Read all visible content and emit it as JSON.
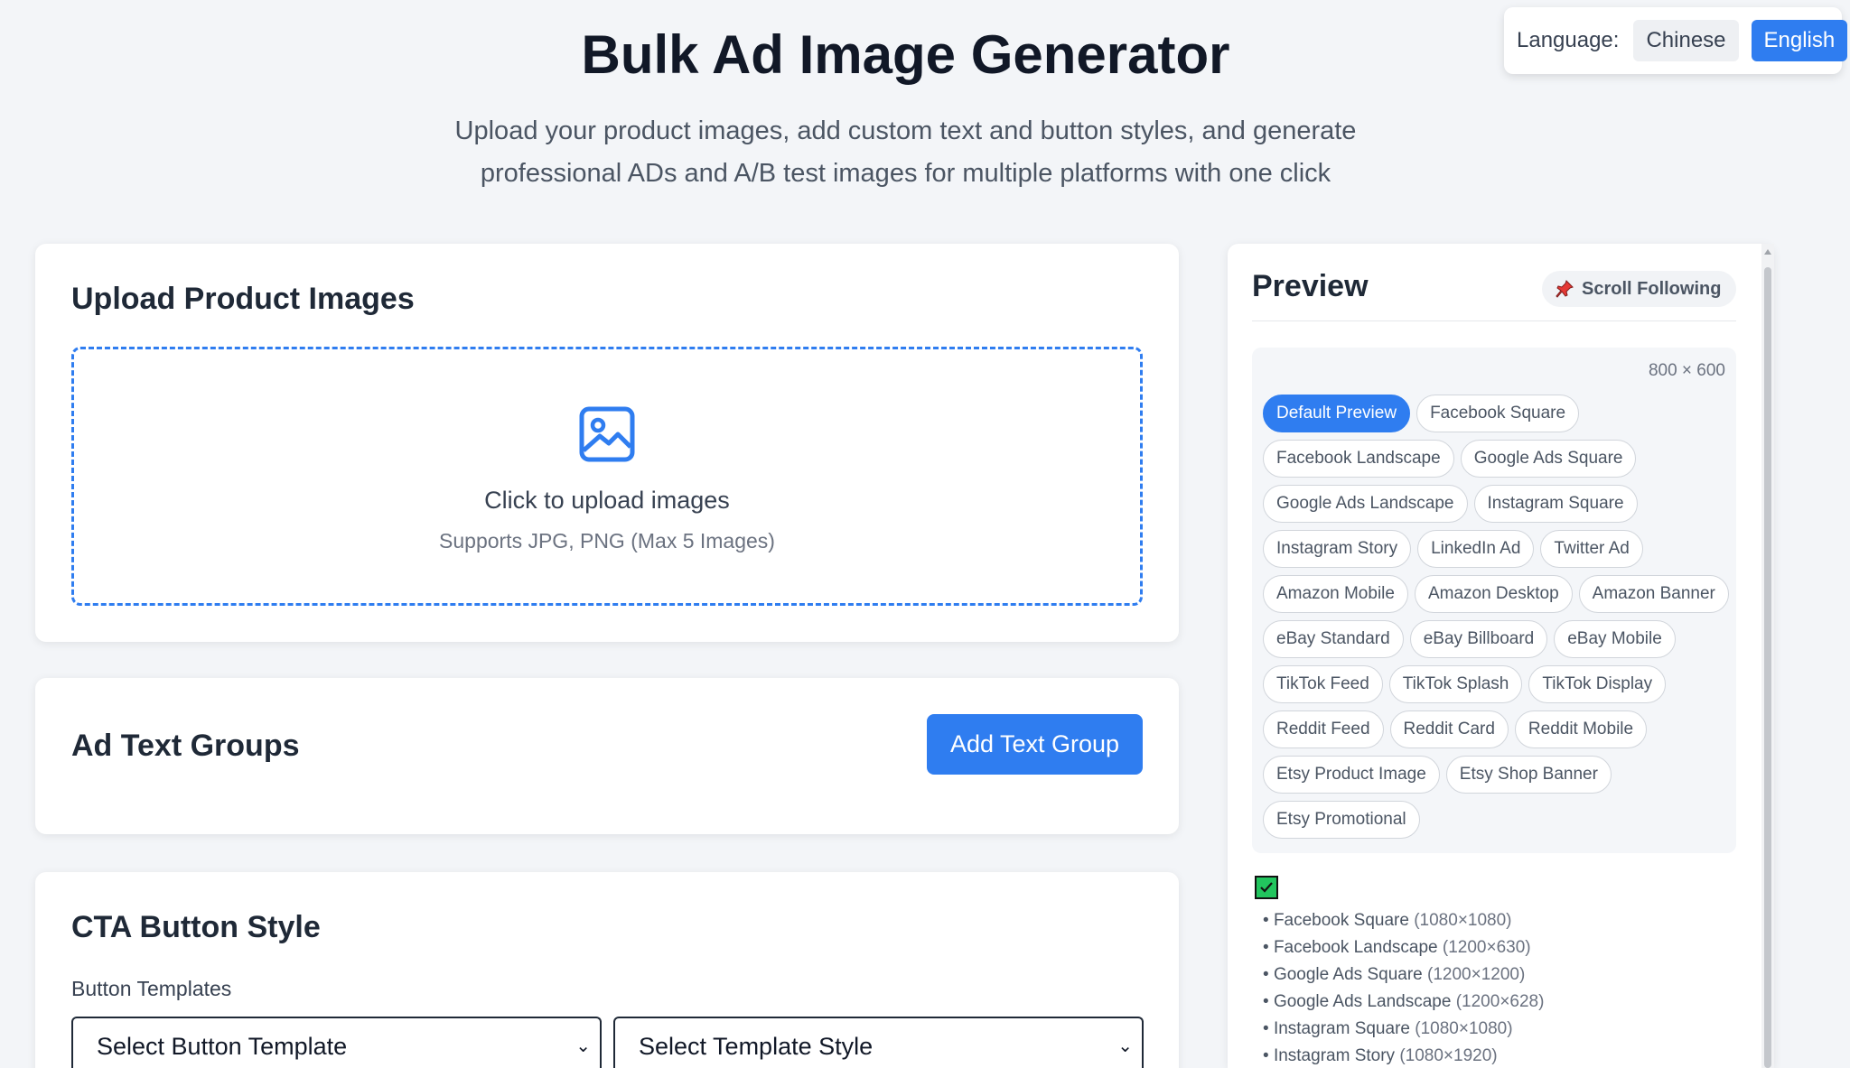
{
  "language": {
    "label": "Language:",
    "options": [
      "Chinese",
      "English"
    ],
    "selected": "English"
  },
  "header": {
    "title": "Bulk Ad Image Generator",
    "subtitle_line1": "Upload your product images, add custom text and button styles, and generate",
    "subtitle_line2": "professional ADs and A/B test images for multiple platforms with one click"
  },
  "upload": {
    "title": "Upload Product Images",
    "prompt": "Click to upload images",
    "hint": "Supports JPG, PNG (Max 5 Images)",
    "icon": "image-icon"
  },
  "text_groups": {
    "title": "Ad Text Groups",
    "add_label": "Add Text Group"
  },
  "cta": {
    "title": "CTA Button Style",
    "templates_label": "Button Templates",
    "template_select": "Select Button Template",
    "style_select": "Select Template Style"
  },
  "preview": {
    "title": "Preview",
    "scroll_following": "Scroll Following",
    "dimensions": "800 × 600",
    "sizes": [
      "Default Preview",
      "Facebook Square",
      "Facebook Landscape",
      "Google Ads Square",
      "Google Ads Landscape",
      "Instagram Square",
      "Instagram Story",
      "LinkedIn Ad",
      "Twitter Ad",
      "Amazon Mobile",
      "Amazon Desktop",
      "Amazon Banner",
      "eBay Standard",
      "eBay Billboard",
      "eBay Mobile",
      "TikTok Feed",
      "TikTok Splash",
      "TikTok Display",
      "Reddit Feed",
      "Reddit Card",
      "Reddit Mobile",
      "Etsy Product Image",
      "Etsy Shop Banner",
      "Etsy Promotional"
    ],
    "active_size": "Default Preview",
    "formats": [
      {
        "name": "Facebook Square",
        "dim": "(1080×1080)"
      },
      {
        "name": "Facebook Landscape",
        "dim": "(1200×630)"
      },
      {
        "name": "Google Ads Square",
        "dim": "(1200×1200)"
      },
      {
        "name": "Google Ads Landscape",
        "dim": "(1200×628)"
      },
      {
        "name": "Instagram Square",
        "dim": "(1080×1080)"
      },
      {
        "name": "Instagram Story",
        "dim": "(1080×1920)"
      }
    ]
  },
  "colors": {
    "accent": "#2f7df0",
    "check": "#22c55e"
  }
}
